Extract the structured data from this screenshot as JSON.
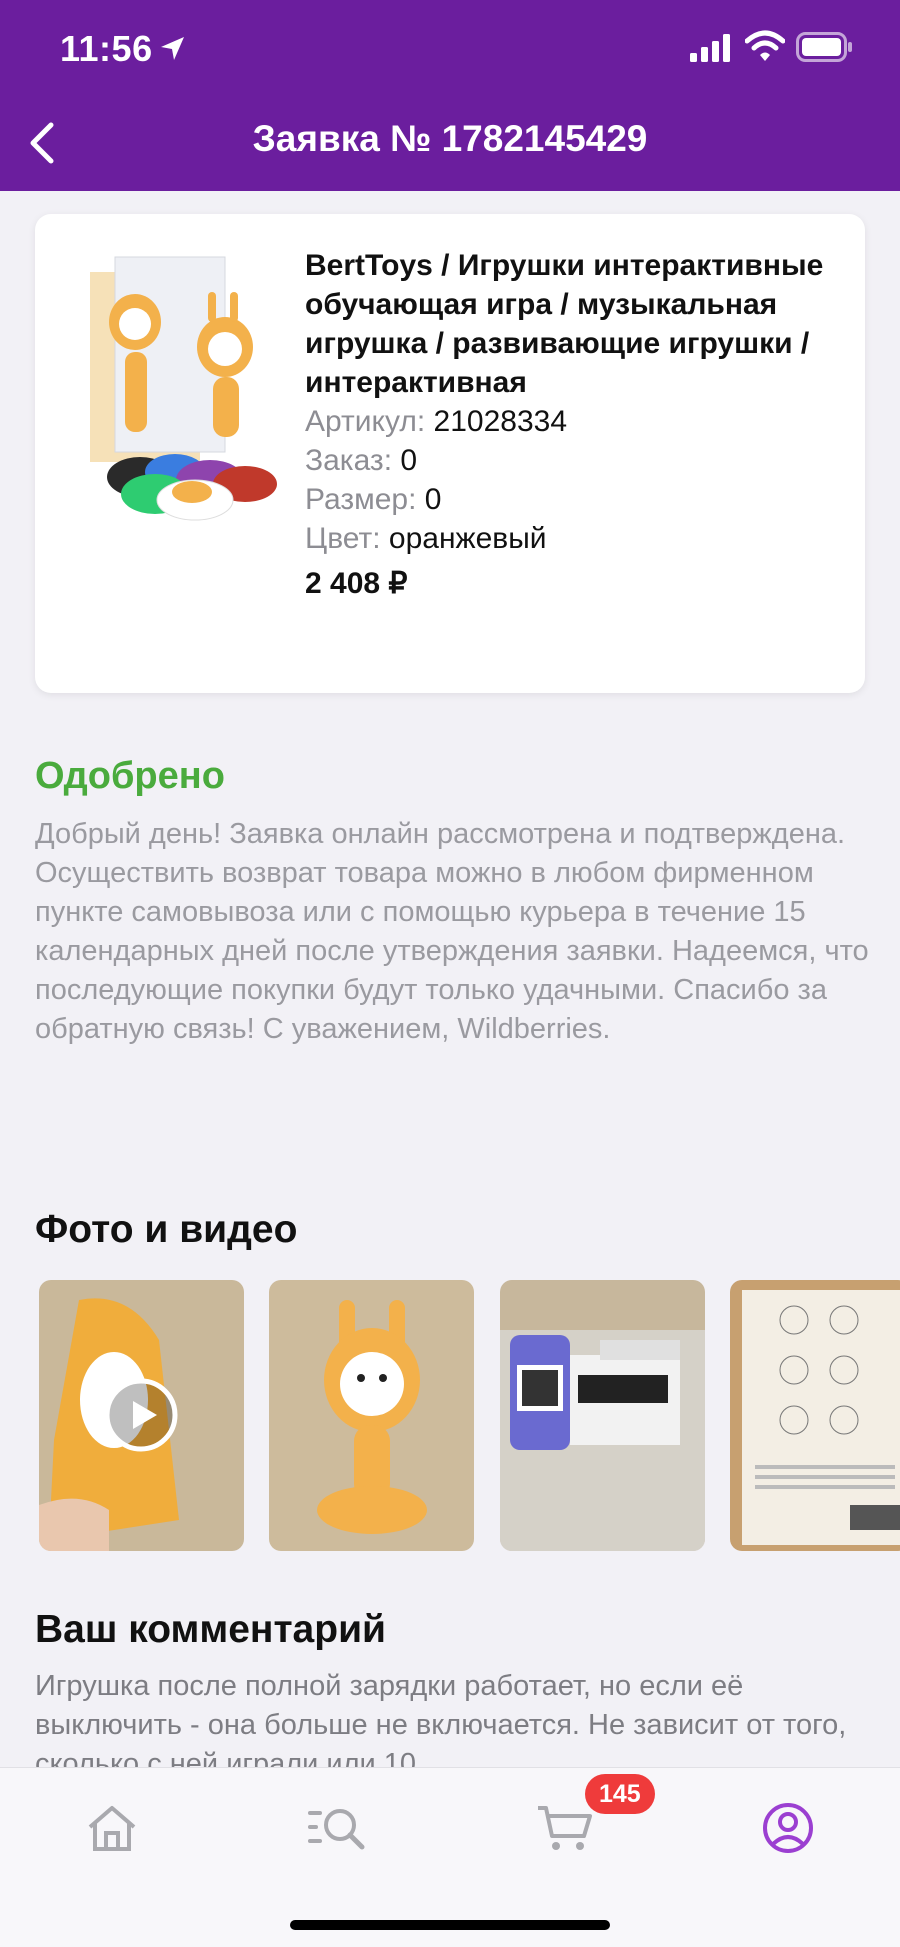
{
  "status_bar": {
    "time": "11:56"
  },
  "header": {
    "title": "Заявка № 1782145429"
  },
  "product": {
    "name": "BertToys / Игрушки интерактивные обучающая игра / музыкальная игрушка / развивающие игрушки / интерактивная",
    "article_label": "Артикул:",
    "article_value": "21028334",
    "order_label": "Заказ:",
    "order_value": "0",
    "size_label": "Размер:",
    "size_value": "0",
    "color_label": "Цвет:",
    "color_value": "оранжевый",
    "price": "2 408 ₽"
  },
  "status": {
    "title": "Одобрено",
    "text": "Добрый день! Заявка онлайн рассмотрена и подтверждена.  Осуществить возврат товара можно в любом фирменном пункте самовывоза или с помощью курьера в течение 15 календарных дней после утверждения заявки. Надеемся, что последующие покупки будут только удачными. Спасибо за обратную связь! С уважением, Wildberries.",
    "color": "#4aab3d"
  },
  "media": {
    "title": "Фото и видео"
  },
  "comment": {
    "title": "Ваш комментарий",
    "text": "Игрушка после полной зарядки работает, но если её выключить - она больше не включается. Не зависит от того, сколько с ней играли или 10"
  },
  "tabbar": {
    "cart_badge": "145",
    "active_color": "#9b3fd1"
  },
  "colors": {
    "brand": "#6b1e9e",
    "badge": "#ef3b3b"
  }
}
